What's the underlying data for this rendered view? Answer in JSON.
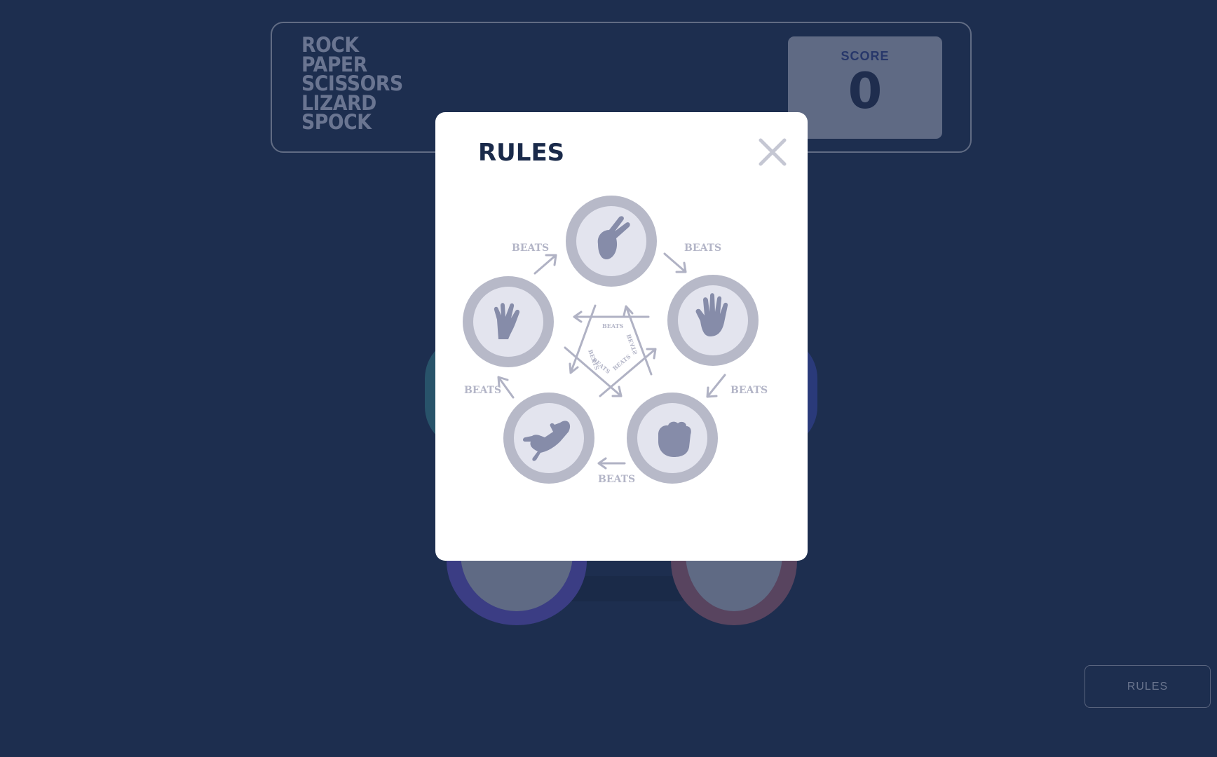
{
  "header": {
    "logo_lines": [
      "ROCK",
      "PAPER",
      "SCISSORS",
      "LIZARD",
      "SPOCK"
    ],
    "score_label": "SCORE",
    "score_value": "0"
  },
  "rules_button_label": "RULES",
  "modal": {
    "title": "RULES",
    "close_icon": "close-icon",
    "beats_label": "BEATS",
    "tokens": [
      "scissors",
      "paper",
      "rock",
      "lizard",
      "spock"
    ]
  },
  "colors": {
    "background": "#1d2e4f",
    "modal_bg": "#ffffff",
    "title": "#1a2a4a",
    "diagram_grey": "#b7b9c8"
  }
}
